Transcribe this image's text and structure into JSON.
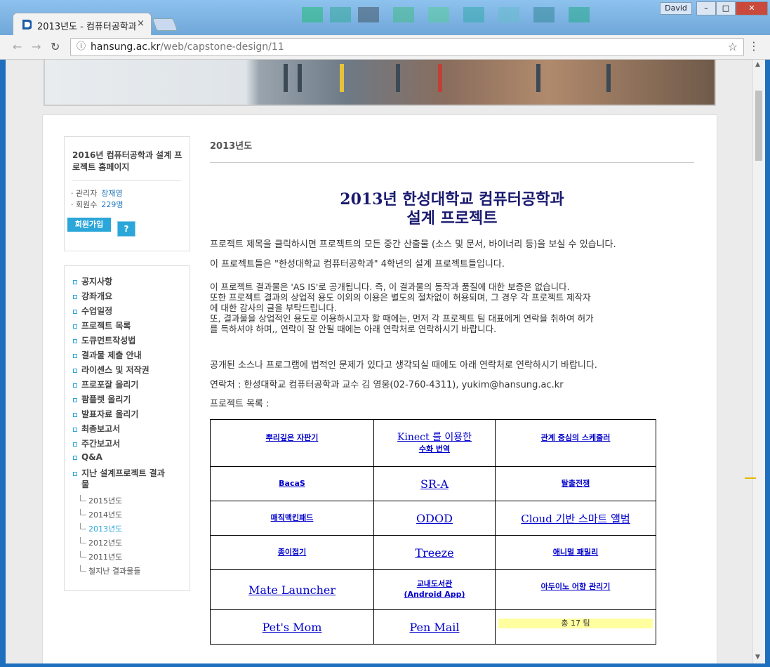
{
  "window": {
    "user_badge": "David",
    "minimize": "–",
    "maximize": "□",
    "close": "✕"
  },
  "tab": {
    "title": "2013년도 - 컴퓨터공학과",
    "close": "×"
  },
  "toolbar": {
    "back": "←",
    "forward": "→",
    "reload": "↻",
    "url_host": "hansung.ac.kr",
    "url_path": "/web/capstone-design/11",
    "star": "☆",
    "menu": "⋮"
  },
  "sidebar": {
    "site_title": "2016년 컴퓨터공학과 설계 프로젝트 홈페이지",
    "admin_label": "· 관리자",
    "admin_value": "장재영",
    "members_label": "· 회원수",
    "members_value": "229명",
    "join_button": "회원가입",
    "help_button": "?",
    "menu": [
      "공지사항",
      "강좌개요",
      "수업일정",
      "프로젝트 목록",
      "도큐먼트작성법",
      "결과물 제출 안내",
      "라이센스 및 저작권",
      "프로포잘 올리기",
      "팜플렛 올리기",
      "발표자료 올리기",
      "최종보고서",
      "주간보고서",
      "Q&A"
    ],
    "past_label_1": "지난 설계프로젝트 결과",
    "past_label_2": "물",
    "past_years": [
      "2015년도",
      "2014년도",
      "2013년도",
      "2012년도",
      "2011년도",
      "철지난 결과물들"
    ]
  },
  "main": {
    "section_title": "2013년도",
    "headline_1": "2013년 한성대학교 컴퓨터공학과",
    "headline_2": "설계 프로젝트",
    "p1": "프로젝트 제목을 클릭하시면 프로젝트의 모든 중간 산출물 (소스 및 문서, 바이너리 등)을 보실 수 있습니다.",
    "p2": "이 프로젝트들은 \"한성대학교 컴퓨터공학과\" 4학년의 설계 프로젝트들입니다.",
    "p3_lines": [
      "이 프로젝트 결과물은 'AS IS'로 공개됩니다. 즉, 이 결과물의 동작과 품질에 대한 보증은 없습니다.",
      "또한 프로젝트 결과의 상업적 용도 이외의 이용은 별도의 절차없이 허용되며, 그 경우 각 프로젝트 제작자",
      "에 대한 감사의 글을 부탁드립니다.",
      "또, 결과물을 상업적인 용도로 이용하시고자 할 때에는, 먼저 각 프로젝트 팀 대표에게 연락을 취하여 허가",
      "를 득하셔야 하며,, 연락이 잘 안될 때에는 아래 연락처로 연락하시기 바랍니다."
    ],
    "p4": "공개된 소스나 프로그램에 법적인 문제가 있다고 생각되실 때에도 아래 연락처로 연락하시기 바랍니다.",
    "p5": "연락처 : 한성대학교 컴퓨터공학과 교수 김 영웅(02-760-4311), yukim@hansung.ac.kr",
    "p6": "프로젝트 목록 :",
    "projects": [
      [
        "뿌리깊은 자판기",
        "Kinect 를 이용한",
        "수화 번역",
        "관계 중심의 스케줄러"
      ],
      [
        "BacaS",
        "SR-A",
        "탈출전쟁"
      ],
      [
        "매직맥킨패드",
        "ODOD",
        "Cloud 기반 스마트 앨범"
      ],
      [
        "종이접기",
        "Treeze",
        "애니멀 패밀리"
      ],
      [
        "Mate Launcher",
        "교내도서관",
        "(Android App)",
        "아두이노 어항 관리기"
      ],
      [
        "Pet's Mom",
        "Pen Mail"
      ]
    ],
    "total": "총 17 팀"
  }
}
